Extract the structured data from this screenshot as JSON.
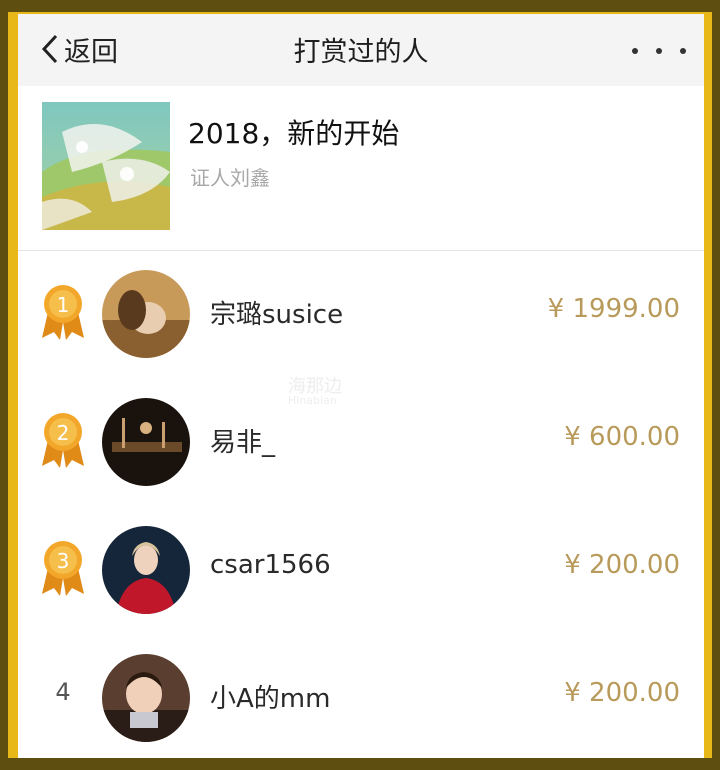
{
  "navbar": {
    "back_label": "返回",
    "title": "打赏过的人"
  },
  "article": {
    "title": "2018，新的开始",
    "author": "证人刘鑫"
  },
  "rewarders": [
    {
      "rank": "1",
      "medal": "gold-medal-icon",
      "name": "宗璐susice",
      "amount": "¥ 1999.00"
    },
    {
      "rank": "2",
      "medal": "gold-medal-icon",
      "name": "易非_",
      "amount": "¥ 600.00"
    },
    {
      "rank": "3",
      "medal": "gold-medal-icon",
      "name": "csar1566",
      "amount": "¥ 200.00"
    },
    {
      "rank": "4",
      "name": "小A的mm",
      "amount": "¥ 200.00"
    }
  ],
  "watermark": {
    "cn": "海那边",
    "en": "Hinabian"
  },
  "colors": {
    "amount": "#b89a5a",
    "medal": "#e9a21f",
    "frame": "#e8b818"
  }
}
